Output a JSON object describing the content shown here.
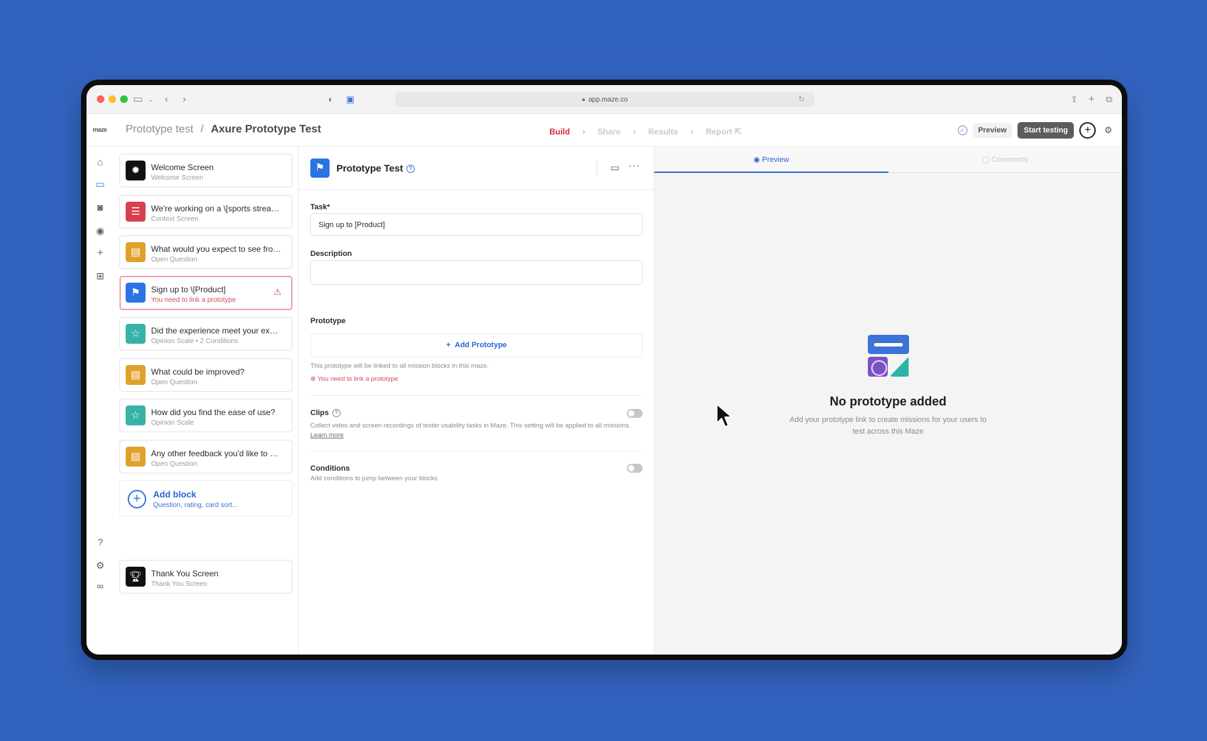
{
  "browser": {
    "url": "app.maze.co",
    "traffic_light_colors": [
      "#ff5f57",
      "#febc2e",
      "#28c840"
    ]
  },
  "header": {
    "logo": "maze",
    "breadcrumb_parent": "Prototype test",
    "breadcrumb_sep": "/",
    "breadcrumb_current": "Axure Prototype Test",
    "steps": [
      {
        "label": "Build",
        "active": true
      },
      {
        "label": "Share",
        "active": false
      },
      {
        "label": "Results",
        "active": false
      },
      {
        "label": "Report",
        "active": false
      }
    ],
    "preview_label": "Preview",
    "start_label": "Start testing"
  },
  "blocks": [
    {
      "title": "Welcome Screen",
      "subtitle": "Welcome Screen",
      "icon": "sun-icon",
      "glyph": "✹",
      "color": "#111111"
    },
    {
      "title": "We're working on a \\[sports streaming app]...",
      "subtitle": "Context Screen",
      "icon": "text-lines-icon",
      "glyph": "☰",
      "color": "#d9404f"
    },
    {
      "title": "What would you expect to see from...",
      "subtitle": "Open Question",
      "icon": "chat-bubble-icon",
      "glyph": "▤",
      "color": "#e0a12b"
    },
    {
      "title": "Sign up to \\[Product]",
      "subtitle": "You need to link a prototype",
      "icon": "flag-icon",
      "glyph": "⚑",
      "color": "#2b73e6",
      "selected": true
    },
    {
      "title": "Did the experience meet your expectations?",
      "subtitle": "Opinion Scale • 2 Conditions",
      "icon": "star-icon",
      "glyph": "☆",
      "color": "#37b2a7"
    },
    {
      "title": "What could be improved?",
      "subtitle": "Open Question",
      "icon": "chat-bubble-icon",
      "glyph": "▤",
      "color": "#e0a12b"
    },
    {
      "title": "How did you find the ease of use?",
      "subtitle": "Opinion Scale",
      "icon": "star-icon",
      "glyph": "☆",
      "color": "#37b2a7"
    },
    {
      "title": "Any other feedback you'd like to add?",
      "subtitle": "Open Question",
      "icon": "chat-bubble-icon",
      "glyph": "▤",
      "color": "#e0a12b"
    }
  ],
  "add_block": {
    "title": "Add block",
    "subtitle": "Question, rating, card sort..."
  },
  "thank_you": {
    "title": "Thank You Screen",
    "subtitle": "Thank You Screen"
  },
  "editor": {
    "title": "Prototype Test",
    "task_label": "Task*",
    "task_value": "Sign up to [Product]",
    "description_label": "Description",
    "description_value": "",
    "prototype_label": "Prototype",
    "add_prototype": "Add Prototype",
    "prototype_note": "This prototype will be linked to all mission blocks in this maze.",
    "prototype_error": "You need to link a prototype",
    "clips_label": "Clips",
    "clips_desc": "Collect video and screen recordings of tester usability tasks in Maze. This setting will be applied to all missions.",
    "learn_more": "Learn more",
    "clips_enabled": false,
    "conditions_label": "Conditions",
    "conditions_desc": "Add conditions to jump between your blocks",
    "conditions_enabled": false
  },
  "preview_panel": {
    "tab_preview": "Preview",
    "tab_comments": "Comments",
    "empty_title": "No prototype added",
    "empty_text": "Add your prototype link to create missions for your users to test across this Maze"
  }
}
